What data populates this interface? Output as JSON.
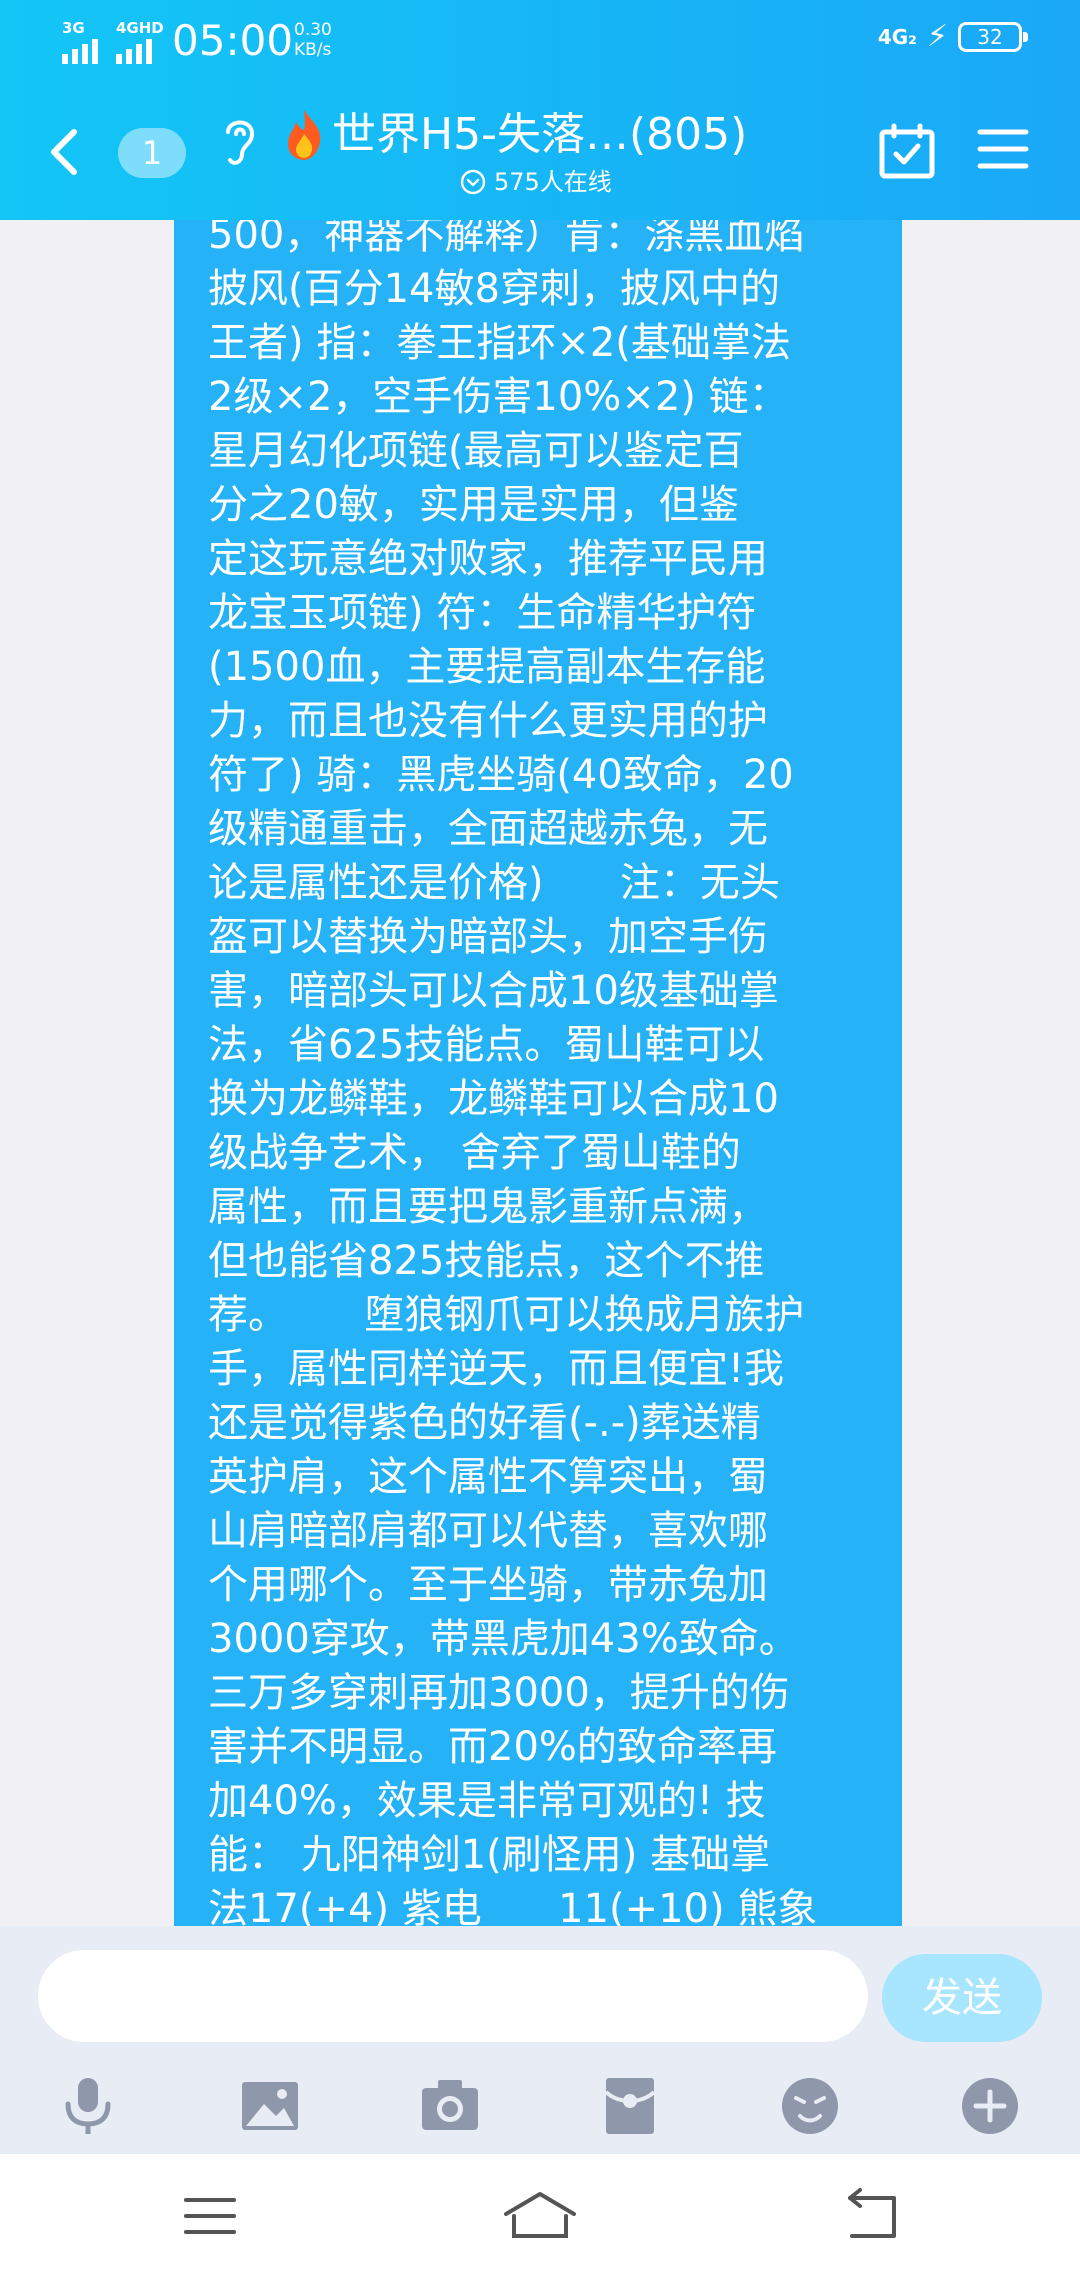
{
  "status_bar": {
    "network1": "3G",
    "network2": "4GHD",
    "time": "05:00",
    "speed_value": "0.30",
    "speed_unit": "KB/s",
    "right_network": "4G₂",
    "battery": "32"
  },
  "header": {
    "badge": "1",
    "title": "世界H5-失落…(805)",
    "online": "575人在线"
  },
  "message": {
    "text": "500，神器不解释）肯：涤黑血焰\n披风(百分14敏8穿刺，披风中的\n王者) 指：拳王指环×2(基础掌法\n2级×2，空手伤害10%×2) 链：\n星月幻化项链(最高可以鉴定百\n分之20敏，实用是实用，但鉴\n定这玩意绝对败家，推荐平民用\n龙宝玉项链) 符：生命精华护符\n(1500血，主要提高副本生存能\n力，而且也没有什么更实用的护\n符了) 骑：黑虎坐骑(40致命，20\n级精通重击，全面超越赤兔，无\n论是属性还是价格)      注：无头\n盔可以替换为暗部头，加空手伤\n害，暗部头可以合成10级基础掌\n法，省625技能点。蜀山鞋可以\n换为龙鳞鞋，龙鳞鞋可以合成10\n级战争艺术， 舍弃了蜀山鞋的\n属性，而且要把鬼影重新点满，\n但也能省825技能点，这个不推\n荐。      堕狼钢爪可以换成月族护\n手，属性同样逆天，而且便宜!我\n还是觉得紫色的好看(-.-)葬送精\n英护肩，这个属性不算突出，蜀\n山肩暗部肩都可以代替，喜欢哪\n个用哪个。至于坐骑，带赤兔加\n3000穿攻，带黑虎加43%致命。\n三万多穿刺再加3000，提升的伤\n害并不明显。而20%的致命率再\n加40%，效果是非常可观的! 技\n能： 九阳神剑1(刷怪用) 基础掌\n法17(+4) 紫电      11(+10) 熊象\n"
  },
  "input": {
    "placeholder": "",
    "send_label": "发送"
  },
  "colors": {
    "header_start": "#13c6f6",
    "header_end": "#1aa8f7",
    "bubble": "#26b2f6",
    "send_button": "#a8e6ff"
  },
  "toolbar_icons": [
    "microphone-icon",
    "image-icon",
    "camera-icon",
    "red-packet-icon",
    "emoji-icon",
    "plus-icon"
  ]
}
